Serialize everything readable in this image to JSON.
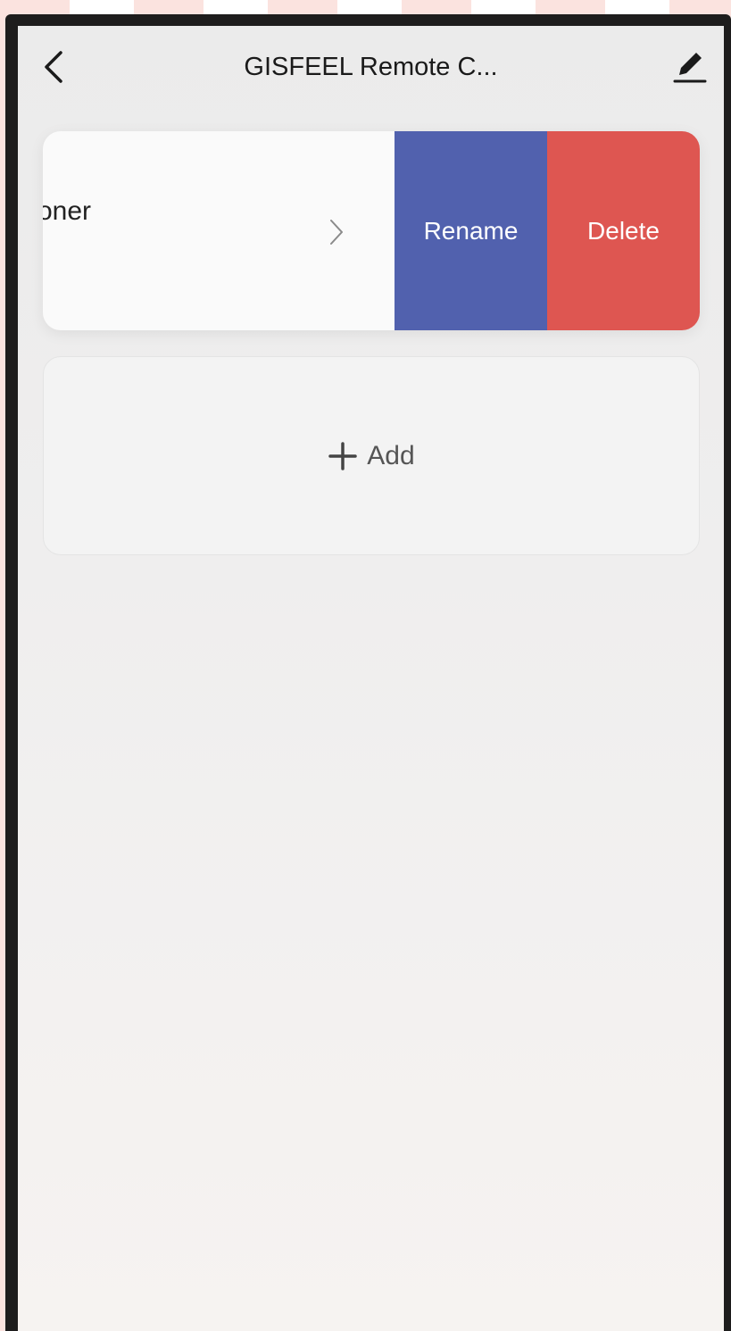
{
  "colors": {
    "rename_bg": "#5161ae",
    "delete_bg": "#de5651",
    "text_dark": "#1a1a1a",
    "add_text": "#555555",
    "frame": "#1e1d1d"
  },
  "nav": {
    "title": "GISFEEL Remote C...",
    "back_icon": "chevron-left-icon",
    "edit_icon": "pencil-icon"
  },
  "device_card": {
    "name": "oner",
    "chevron_icon": "chevron-right-icon",
    "rename_label": "Rename",
    "delete_label": "Delete"
  },
  "add_card": {
    "icon": "plus-icon",
    "label": "Add"
  }
}
